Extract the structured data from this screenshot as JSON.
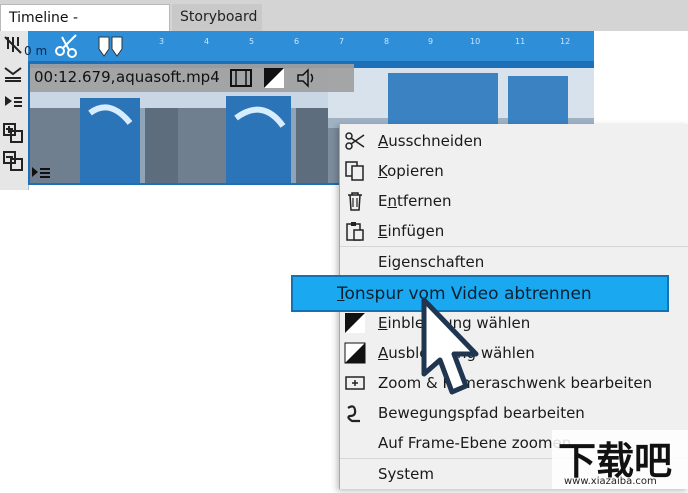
{
  "tabs": {
    "timeline": "Timeline - Spuransicht",
    "storyboard": "Storyboard"
  },
  "ruler": {
    "ticks": [
      "3",
      "4",
      "5",
      "6",
      "7",
      "8",
      "9",
      "10",
      "11",
      "12"
    ],
    "partial_label": "0 m"
  },
  "clip": {
    "time": "00:12.679,",
    "name": "aquasoft.mp4"
  },
  "menu": {
    "items": [
      {
        "u": "A",
        "rest": "usschneiden"
      },
      {
        "u": "K",
        "rest": "opieren"
      },
      {
        "pre": "E",
        "u": "n",
        "rest": "tfernen"
      },
      {
        "u": "E",
        "rest": "infügen"
      },
      {
        "label": "Eigenschaften"
      },
      {
        "u": "T",
        "rest": "onspur vom Video abtrennen"
      },
      {
        "u": "E",
        "rest": "inblendung wählen"
      },
      {
        "u": "A",
        "rest": "usblendung wählen"
      },
      {
        "label": "Zoom & Kameraschwenk bearbeiten"
      },
      {
        "label": "Bewegungspfad bearbeiten"
      },
      {
        "label": "Auf Frame-Ebene zoomen"
      },
      {
        "label": "System"
      }
    ]
  },
  "watermark": {
    "logo_text": "下载吧",
    "url": "www.xiazaiba.com"
  },
  "colors": {
    "accent": "#1aa9f0",
    "ruler": "#2e8fd8",
    "track": "#1d6fb8",
    "menu_bg": "#f0f0f0"
  }
}
